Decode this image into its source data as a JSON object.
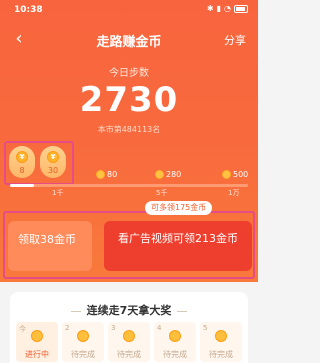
{
  "status": {
    "time": "10:38"
  },
  "nav": {
    "back_icon": "back-icon",
    "title": "走路赚金币",
    "share": "分享"
  },
  "steps": {
    "label": "今日步数",
    "count": "2730",
    "rank": "本市第484113名",
    "progress_percent": 10
  },
  "bubbles": [
    {
      "value": "8"
    },
    {
      "value": "30"
    }
  ],
  "milestones": [
    {
      "coins": "80",
      "mark": "1千"
    },
    {
      "coins": "280",
      "mark": "5千"
    },
    {
      "coins": "500",
      "mark": "1万"
    }
  ],
  "hint": "可多领175金币",
  "buttons": {
    "claim": "领取38金币",
    "ad": "看广告视频可领213金币"
  },
  "streak": {
    "title": "连续走7天拿大奖",
    "days": [
      {
        "num": "今",
        "text": "进行中"
      },
      {
        "num": "2",
        "text": "待完成"
      },
      {
        "num": "3",
        "text": "待完成"
      },
      {
        "num": "4",
        "text": "待完成"
      },
      {
        "num": "5",
        "text": "待完成"
      }
    ]
  },
  "colors": {
    "primary": "#f8643e",
    "accent": "#ee3f2e",
    "highlight": "#e84c86"
  }
}
